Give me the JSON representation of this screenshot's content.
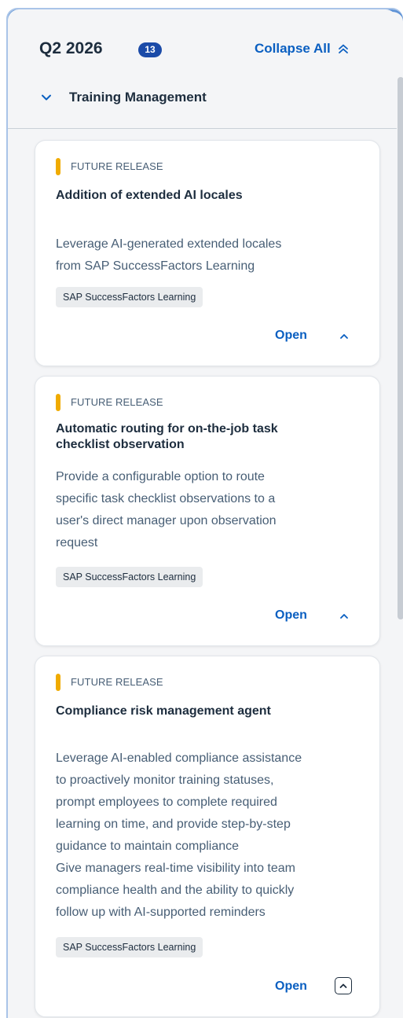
{
  "header": {
    "quarter": "Q2 2026",
    "count": "13",
    "collapse_all": "Collapse All",
    "group_name": "Training Management"
  },
  "cards": [
    {
      "status": "FUTURE RELEASE",
      "title": "Addition of extended AI locales",
      "description_lines": [
        "Leverage AI-generated extended locales",
        "from SAP SuccessFactors Learning"
      ],
      "tag": "SAP SuccessFactors Learning",
      "open_label": "Open"
    },
    {
      "status": "FUTURE RELEASE",
      "title_lines": [
        "Automatic routing for on-the-job task",
        "checklist observation"
      ],
      "description_lines": [
        "Provide a configurable option to route",
        "specific task checklist observations to a",
        "user's direct manager upon observation",
        "request"
      ],
      "tag": "SAP SuccessFactors Learning",
      "open_label": "Open"
    },
    {
      "status": "FUTURE RELEASE",
      "title": "Compliance risk management agent",
      "description_lines": [
        "Leverage AI-enabled compliance assistance",
        "to proactively monitor training statuses,",
        "prompt employees to complete required",
        "learning on time, and provide step-by-step",
        "guidance to maintain compliance",
        "Give managers real-time visibility into team",
        "compliance health and the ability to quickly",
        "follow up with AI-supported reminders"
      ],
      "tag": "SAP SuccessFactors Learning",
      "open_label": "Open"
    }
  ],
  "colors": {
    "accent": "#0a5fc1",
    "badge": "#1b4ba8",
    "status_indicator": "#f0ab00"
  },
  "icons": {
    "collapse_all": "double-chevron-up-icon",
    "group_toggle": "chevron-down-icon",
    "card_toggle": "chevron-up-icon"
  }
}
